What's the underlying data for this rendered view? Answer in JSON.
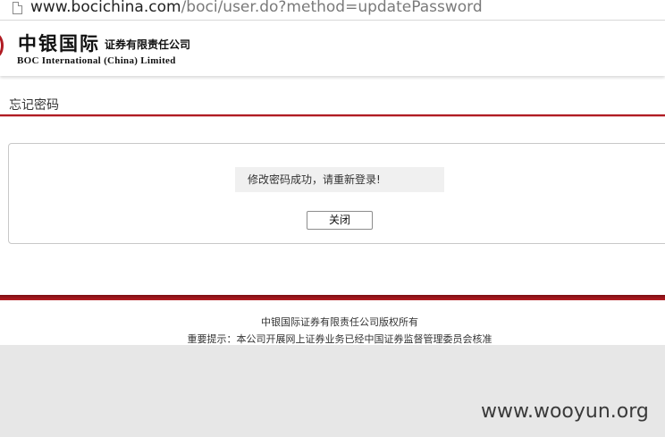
{
  "browser": {
    "url_host": "www.bocichina.com",
    "url_path": "/boci/user.do?method=updatePassword"
  },
  "header": {
    "brand_cn": "中银国际",
    "brand_cn_sub": "证券有限责任公司",
    "brand_en": "BOC International (China) Limited"
  },
  "page": {
    "title": "忘记密码",
    "message": "修改密码成功，请重新登录!",
    "close_label": "关闭"
  },
  "footer": {
    "copyright": "中银国际证券有限责任公司版权所有",
    "notice": "重要提示：本公司开展网上证券业务已经中国证券监督管理委员会核准"
  },
  "watermark": "www.wooyun.org",
  "colors": {
    "accent": "#b01b22",
    "message_bg": "#f0f0f0",
    "footer_gray": "#e7e7e7"
  },
  "icons": {
    "address_bar": "page-icon",
    "brand": "boc-logo-icon"
  }
}
